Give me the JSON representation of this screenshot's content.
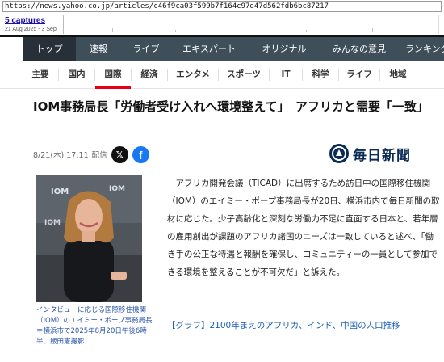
{
  "wayback": {
    "url": "https://news.yahoo.co.jp/articles/c46f9ca03f599b7f164c97e47d562fdb6bc87217",
    "captures_label": "5 captures",
    "date_range": "21 Aug 2025 - 3 Sep"
  },
  "main_nav": {
    "items": [
      {
        "label": "トップ",
        "active": true
      },
      {
        "label": "速報"
      },
      {
        "label": "ライブ"
      },
      {
        "label": "エキスパート"
      },
      {
        "label": "オリジナル"
      },
      {
        "label": "みんなの意見"
      },
      {
        "label": "ランキング"
      }
    ]
  },
  "sub_nav": {
    "items": [
      {
        "label": "主要"
      },
      {
        "label": "国内"
      },
      {
        "label": "国際",
        "active": true
      },
      {
        "label": "経済"
      },
      {
        "label": "エンタメ"
      },
      {
        "label": "スポーツ"
      },
      {
        "label": "IT"
      },
      {
        "label": "科学"
      },
      {
        "label": "ライフ"
      },
      {
        "label": "地域"
      }
    ]
  },
  "article": {
    "headline": "IOM事務局長「労働者受け入れへ環境整えて」　アフリカと需要「一致」",
    "date": "8/21(木) 17:11",
    "meta_label": "配信",
    "share_x_icon": "x-logo-icon",
    "share_facebook_icon": "facebook-icon",
    "publisher": "毎日新聞",
    "body": "アフリカ開発会議（TICAD）に出席するため訪日中の国際移住機関（IOM）のエイミー・ポープ事務局長が20日、横浜市内で毎日新聞の取材に応じた。少子高齢化と深刻な労働力不足に直面する日本と、若年層の雇用創出が課題のアフリカ諸国のニーズは一致していると述べ、「働き手の公正な待遇と報酬を確保し、コミュニティーの一員として参加できる環境を整えることが不可欠だ」と訴えた。",
    "photo_caption": "インタビューに応じる国際移住機関（IOM）のエイミー・ポープ事務局長＝横浜市で2025年8月20日午後6時半、飯田憲撮影",
    "related_link": "【グラフ】2100年まえのアフリカ、インド、中国の人口推移"
  },
  "colors": {
    "nav_bg": "#3f4f5a",
    "nav_active": "#273038",
    "accent_red": "#e60012",
    "link_blue": "#1a5fb4",
    "publisher_navy": "#0b2a55"
  }
}
